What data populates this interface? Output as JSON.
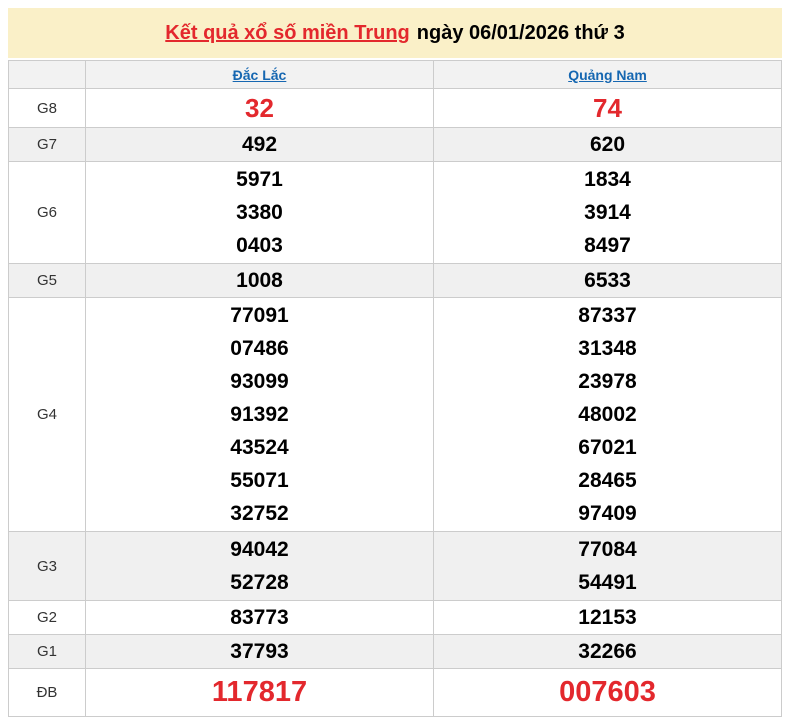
{
  "banner": {
    "title_link": "Kết quả xổ số miền Trung",
    "title_date": "ngày 06/01/2026 thứ 3"
  },
  "table": {
    "corner_label": "",
    "columns": [
      "Đắc Lắc",
      "Quảng Nam"
    ],
    "rows": [
      {
        "label": "G8",
        "class": "prize-red-medium",
        "cells": [
          [
            "32"
          ],
          [
            "74"
          ]
        ]
      },
      {
        "label": "G7",
        "class": "",
        "cells": [
          [
            "492"
          ],
          [
            "620"
          ]
        ]
      },
      {
        "label": "G6",
        "class": "",
        "cells": [
          [
            "5971",
            "3380",
            "0403"
          ],
          [
            "1834",
            "3914",
            "8497"
          ]
        ]
      },
      {
        "label": "G5",
        "class": "",
        "cells": [
          [
            "1008"
          ],
          [
            "6533"
          ]
        ]
      },
      {
        "label": "G4",
        "class": "",
        "cells": [
          [
            "77091",
            "07486",
            "93099",
            "91392",
            "43524",
            "55071",
            "32752"
          ],
          [
            "87337",
            "31348",
            "23978",
            "48002",
            "67021",
            "28465",
            "97409"
          ]
        ]
      },
      {
        "label": "G3",
        "class": "",
        "cells": [
          [
            "94042",
            "52728"
          ],
          [
            "77084",
            "54491"
          ]
        ]
      },
      {
        "label": "G2",
        "class": "",
        "cells": [
          [
            "83773"
          ],
          [
            "12153"
          ]
        ]
      },
      {
        "label": "G1",
        "class": "",
        "cells": [
          [
            "37793"
          ],
          [
            "32266"
          ]
        ]
      },
      {
        "label": "ĐB",
        "class": "prize-red-large",
        "cells": [
          [
            "117817"
          ],
          [
            "007603"
          ]
        ]
      }
    ]
  },
  "colors": {
    "banner_bg": "#faf0c8",
    "highlight_red": "#e3282d",
    "link_blue": "#1667b1",
    "stripe_row": "#f0f0f0",
    "header_row": "#f2f2f2",
    "border": "#cccccc"
  }
}
